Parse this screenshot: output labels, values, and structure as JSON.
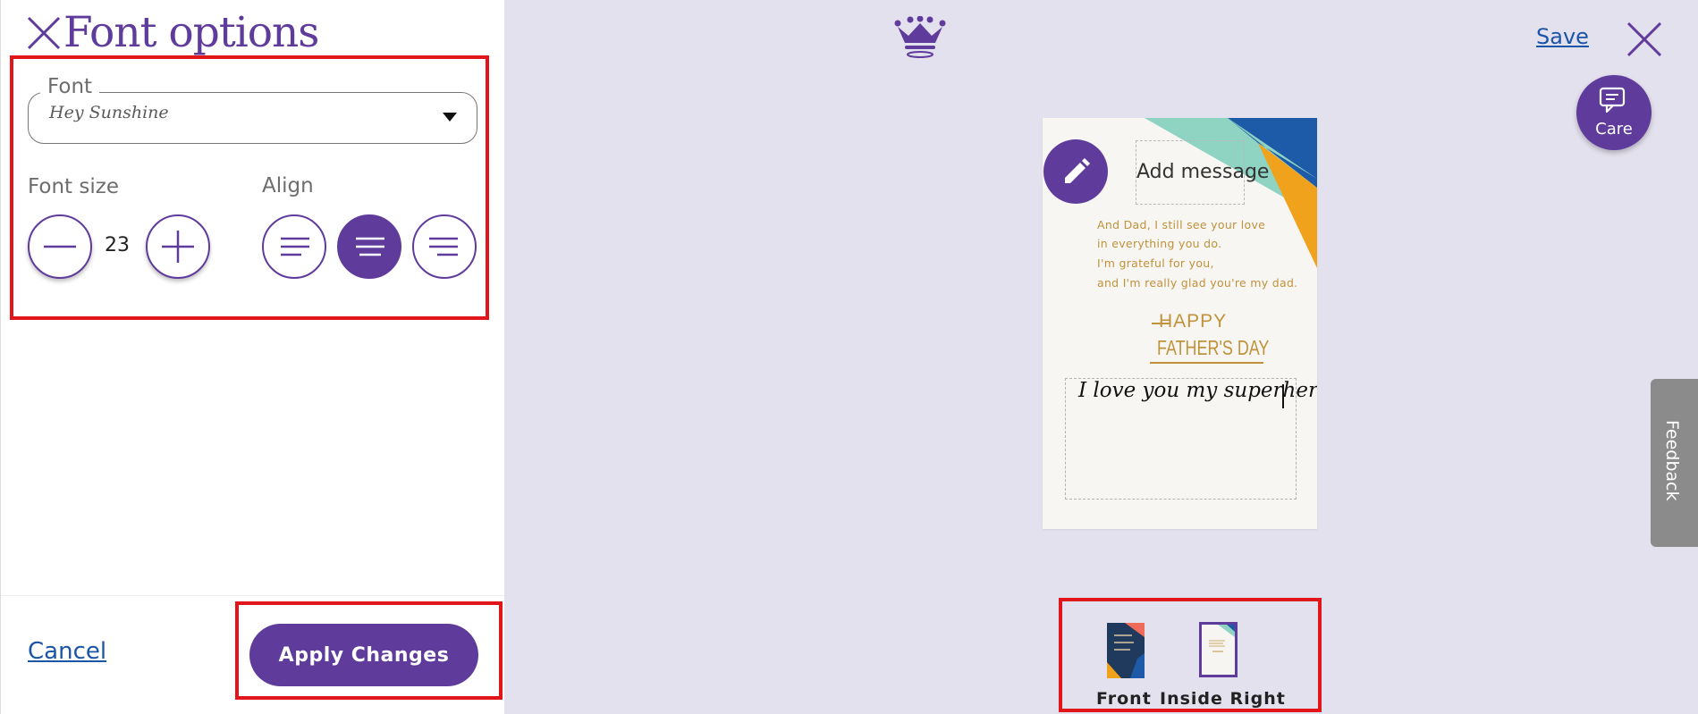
{
  "panel": {
    "title": "Font options",
    "font": {
      "label": "Font",
      "selected": "Hey Sunshine"
    },
    "font_size": {
      "label": "Font size",
      "value": "23"
    },
    "align": {
      "label": "Align",
      "options": [
        "left",
        "center",
        "right"
      ],
      "selected": "center"
    },
    "cancel_label": "Cancel",
    "apply_label": "Apply Changes"
  },
  "header": {
    "logo_icon": "crown-icon",
    "save_label": "Save",
    "care_label": "Care"
  },
  "feedback_label": "Feedback",
  "card": {
    "add_message_label": "Add message",
    "verse": [
      "And Dad, I still see your love",
      "in everything you do.",
      "I'm grateful for you,",
      "and I'm really glad you're my dad."
    ],
    "headline_line1": "HAPPY",
    "headline_line2": "FATHER'S DAY",
    "user_text": "I love you my superhero"
  },
  "thumbnails": [
    {
      "label": "Front"
    },
    {
      "label": "Inside Right"
    }
  ],
  "colors": {
    "brand_purple": "#5f3b9c",
    "link_blue": "#1a55a6",
    "highlight_red": "#e0161b",
    "canvas_bg": "#e4e1ee"
  }
}
